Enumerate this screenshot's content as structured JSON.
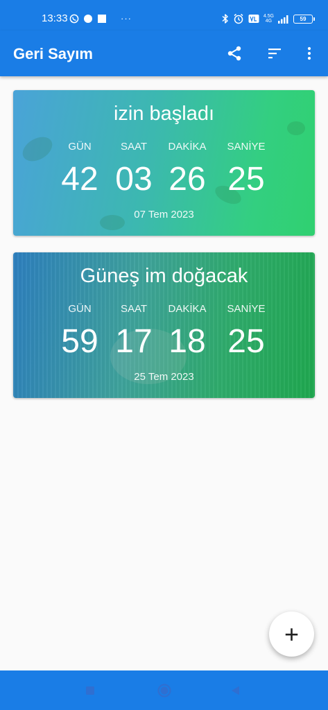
{
  "status_bar": {
    "time": "13:33",
    "more_dots": "···",
    "network_top": "4.5G",
    "network_bottom": "4G",
    "battery": "59"
  },
  "app_bar": {
    "title": "Geri Sayım",
    "icons": [
      "share-icon",
      "sort-icon",
      "more-vert-icon"
    ]
  },
  "countdowns": [
    {
      "title": "izin başladı",
      "units": [
        "GÜN",
        "SAAT",
        "DAKİKA",
        "SANİYE"
      ],
      "values": [
        "42",
        "03",
        "26",
        "25"
      ],
      "date": "07 Tem 2023"
    },
    {
      "title": "Güneş im doğacak",
      "units": [
        "GÜN",
        "SAAT",
        "DAKİKA",
        "SANİYE"
      ],
      "values": [
        "59",
        "17",
        "18",
        "25"
      ],
      "date": "25 Tem 2023"
    }
  ],
  "fab": {
    "label": "+"
  },
  "nav_bar": {
    "icons": [
      "recents-icon",
      "home-icon",
      "back-icon"
    ]
  },
  "colors": {
    "primary": "#1a7de6",
    "background": "#fafafa",
    "fab_background": "#ffffff"
  }
}
